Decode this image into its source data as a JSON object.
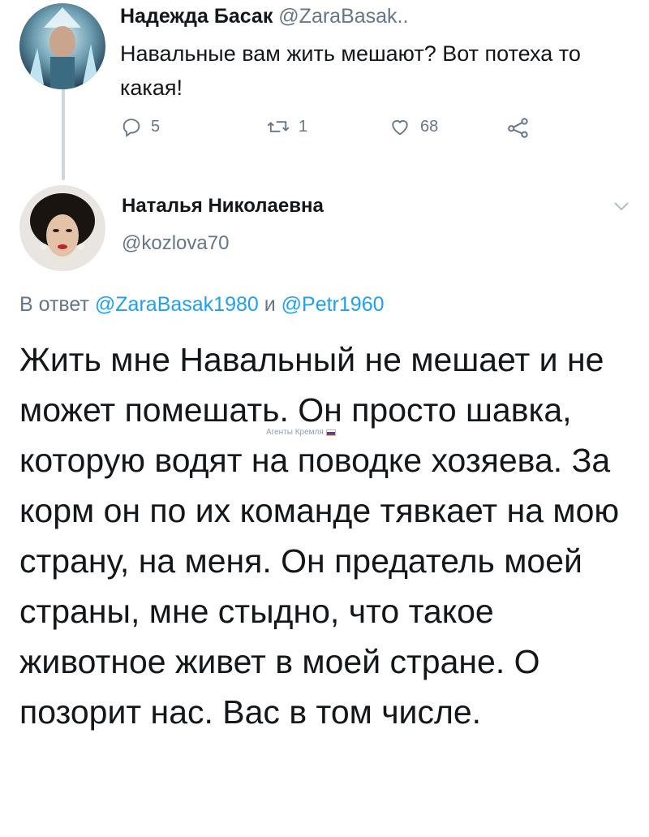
{
  "tweet1": {
    "author_name": "Надежда Басак",
    "author_handle": "@ZaraBasak..",
    "text": "Навальные вам жить мешают? Вот потеха то какая!",
    "reply_count": "5",
    "retweet_count": "1",
    "like_count": "68",
    "icons": [
      "reply-icon",
      "retweet-icon",
      "like-icon",
      "share-icon"
    ]
  },
  "tweet2": {
    "author_name": "Наталья Николаевна",
    "author_handle": "@kozlova70",
    "reply_prefix": "В ответ ",
    "reply_mention1": "@ZaraBasak1980",
    "reply_joiner": " и ",
    "reply_mention2": "@Petr1960",
    "text": "Жить мне Навальный не мешает и не может помешать. Он просто шавка, которую водят на поводке хозяева. За корм он по их команде тявкает на мою страну, на меня. Он предатель моей страны, мне стыдно, что такое животное живет в моей стране. О позорит нас. Вас в том числе."
  },
  "watermark": {
    "text": "Агенты Кремля"
  },
  "colors": {
    "accent": "#1da1f2",
    "muted": "#657786",
    "text": "#14171a",
    "thread": "#ccd6dd"
  }
}
